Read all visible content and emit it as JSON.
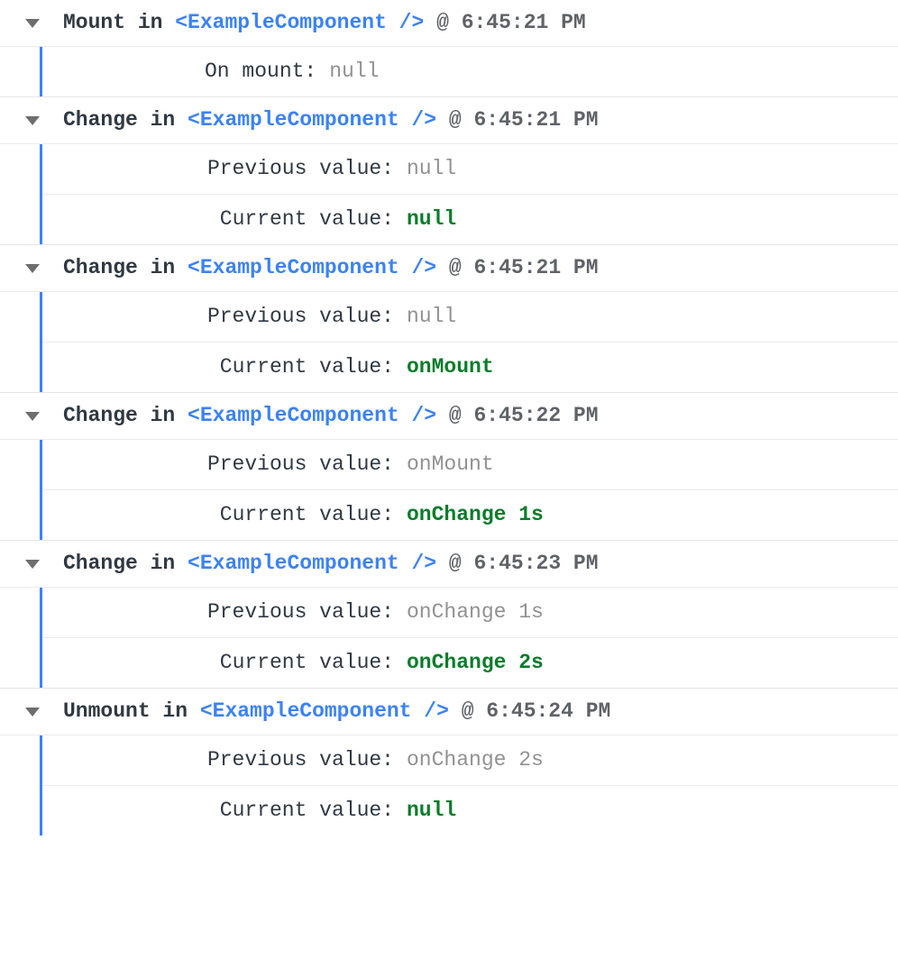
{
  "component": "<ExampleComponent />",
  "labels": {
    "on_mount": "On mount:",
    "prev": "Previous value:",
    "curr": "Current value:"
  },
  "entries": [
    {
      "event": "Mount",
      "time": "6:45:21 PM",
      "mount_value": "null",
      "mount_value_style": "gray"
    },
    {
      "event": "Change",
      "time": "6:45:21 PM",
      "prev": "null",
      "prev_style": "gray",
      "curr": "null",
      "curr_style": "green"
    },
    {
      "event": "Change",
      "time": "6:45:21 PM",
      "prev": "null",
      "prev_style": "gray",
      "curr": "onMount",
      "curr_style": "green"
    },
    {
      "event": "Change",
      "time": "6:45:22 PM",
      "prev": "onMount",
      "prev_style": "gray",
      "curr": "onChange 1s",
      "curr_style": "green"
    },
    {
      "event": "Change",
      "time": "6:45:23 PM",
      "prev": "onChange 1s",
      "prev_style": "gray",
      "curr": "onChange 2s",
      "curr_style": "green"
    },
    {
      "event": "Unmount",
      "time": "6:45:24 PM",
      "prev": "onChange 2s",
      "prev_style": "gray",
      "curr": "null",
      "curr_style": "green"
    }
  ]
}
